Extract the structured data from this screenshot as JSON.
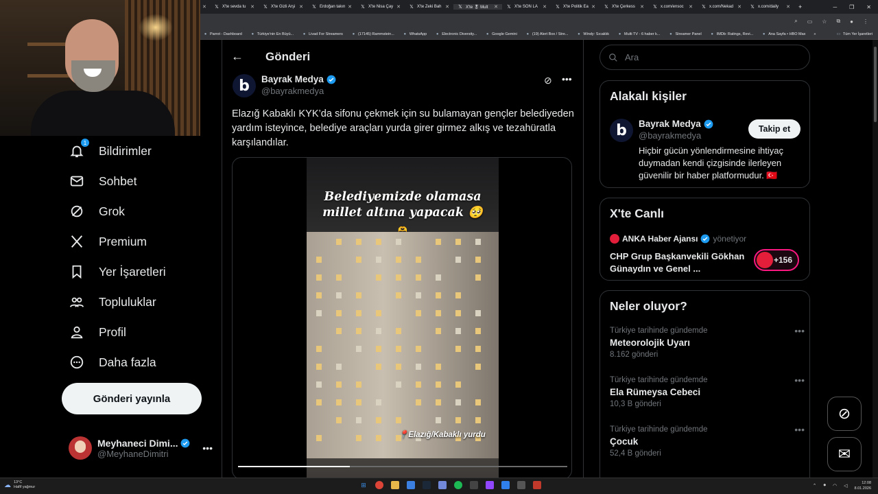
{
  "browser": {
    "tabs": [
      {
        "label": "X'te sevda tu",
        "active": false
      },
      {
        "label": "X'te Gizli Arşi",
        "active": false
      },
      {
        "label": "Erdoğan takın",
        "active": false
      },
      {
        "label": "X'te Nisa Çay",
        "active": false
      },
      {
        "label": "X'te Zeki Bah",
        "active": false
      },
      {
        "label": "X'te 🎖 Mult",
        "active": true
      },
      {
        "label": "X'te SON LA",
        "active": false
      },
      {
        "label": "X'te Politik Ea",
        "active": false
      },
      {
        "label": "X'te Çerkess",
        "active": false
      },
      {
        "label": "x.com/ensoc",
        "active": false
      },
      {
        "label": "x.com/Nekad",
        "active": false
      },
      {
        "label": "x.com/daily",
        "active": false
      }
    ],
    "new_tab": "+",
    "bookmarks": [
      "Parrot - Dashboard",
      "Türkiye'nin En Büyü...",
      "Livad For Streamers",
      "(17145) Rammstein...",
      "WhatsApp",
      "Electronic Diversity...",
      "Google Gemini",
      "(19) Alert Box / Stre...",
      "Windy: Sıcaklık",
      "Multi TV - 6 haber k...",
      "Streamer Panel",
      "IMDb: Ratings, Revi...",
      "Ana Sayfa • HBO Max"
    ],
    "bookmarks_more": "»",
    "all_bookmarks": "Tüm Yer İşaretleri"
  },
  "sidebar": {
    "notification_badge": "1",
    "items": [
      {
        "label": "Bildirimler",
        "icon": "bell-icon"
      },
      {
        "label": "Sohbet",
        "icon": "mail-icon"
      },
      {
        "label": "Grok",
        "icon": "grok-icon"
      },
      {
        "label": "Premium",
        "icon": "x-logo-icon"
      },
      {
        "label": "Yer İşaretleri",
        "icon": "bookmark-icon"
      },
      {
        "label": "Topluluklar",
        "icon": "communities-icon"
      },
      {
        "label": "Profil",
        "icon": "profile-icon"
      },
      {
        "label": "Daha fazla",
        "icon": "more-circle-icon"
      }
    ],
    "post_button": "Gönderi yayınla",
    "account": {
      "name": "Meyhaneci Dimi...",
      "handle": "@MeyhaneDimitri",
      "more": "•••"
    }
  },
  "post": {
    "header_title": "Gönderi",
    "author": {
      "name": "Bayrak Medya",
      "handle": "@bayrakmedya",
      "logo_letter": "b"
    },
    "text": "Elazığ Kabaklı KYK’da sifonu çekmek için su bulamayan gençler belediyeden yardım isteyince, belediye araçları yurda girer girmez alkış ve tezahüratla karşılandılar.",
    "video": {
      "overlay_line1": "Belediyemizde olamasa",
      "overlay_line2": "millet altına yapacak 🥺",
      "overlay_emoji": "🫶",
      "location_caption": "📍Elazığ/Kabaklı yurdu",
      "progress_fraction": 0.34
    }
  },
  "right": {
    "search_placeholder": "Ara",
    "related": {
      "title": "Alakalı kişiler",
      "name": "Bayrak Medya",
      "handle": "@bayrakmedya",
      "bio": "Hiçbir gücün yönlendirmesine ihtiyaç duymadan kendi çizgisinde ilerleyen güvenilir bir haber platformudur. 🇹🇷",
      "follow": "Takip et",
      "logo_letter": "b"
    },
    "live": {
      "title": "X'te Canlı",
      "host": "ANKA Haber Ajansı",
      "host_suffix": "yönetiyor",
      "space_title": "CHP Grup Başkanvekili Gökhan Günaydın ve Genel ...",
      "count": "+156"
    },
    "trends": {
      "title": "Neler oluyor?",
      "items": [
        {
          "context": "Türkiye tarihinde gündemde",
          "topic": "Meteorolojik Uyarı",
          "posts": "8.162 gönderi"
        },
        {
          "context": "Türkiye tarihinde gündemde",
          "topic": "Ela Rümeysa Cebeci",
          "posts": "10,3 B gönderi"
        },
        {
          "context": "Türkiye tarihinde gündemde",
          "topic": "Çocuk",
          "posts": "52,4 B gönderi"
        }
      ]
    }
  },
  "taskbar": {
    "weather_temp": "13°C",
    "weather_desc": "Hafif yağmur",
    "time": "12:08",
    "date": "8.01.2026"
  },
  "colors": {
    "accent": "#1d9bf0",
    "live": "#f91880",
    "background": "#000000"
  }
}
